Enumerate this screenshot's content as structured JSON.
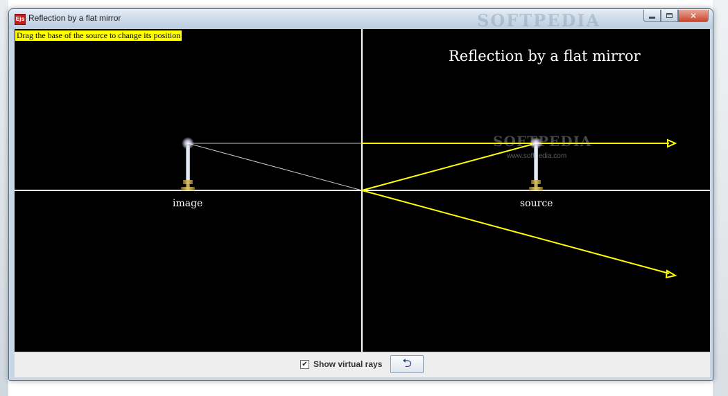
{
  "window": {
    "title": "Reflection by a flat mirror",
    "app_icon_text": "Ejs",
    "title_watermark": "SOFTPEDIA"
  },
  "caption_buttons": {
    "minimize": "minimize-icon",
    "maximize": "maximize-icon",
    "close": "✕"
  },
  "canvas": {
    "instruction": "Drag the base of the source to change its position",
    "title": "Reflection by a flat mirror",
    "image_label": "image",
    "source_label": "source",
    "watermark_main": "SOFTPEDIA",
    "watermark_sub": "www.softpedia.com",
    "colors": {
      "background": "#000000",
      "ray": "#ffff00",
      "virtual_ray": "#c8c8c8",
      "axis": "#ffffff",
      "instruction_bg": "#ffff00"
    }
  },
  "controls": {
    "show_virtual_rays": {
      "label": "Show virtual rays",
      "checked": true,
      "mark": "✔"
    },
    "reset_button": {
      "icon": "undo-arrow-icon",
      "glyph": "⮌"
    }
  }
}
